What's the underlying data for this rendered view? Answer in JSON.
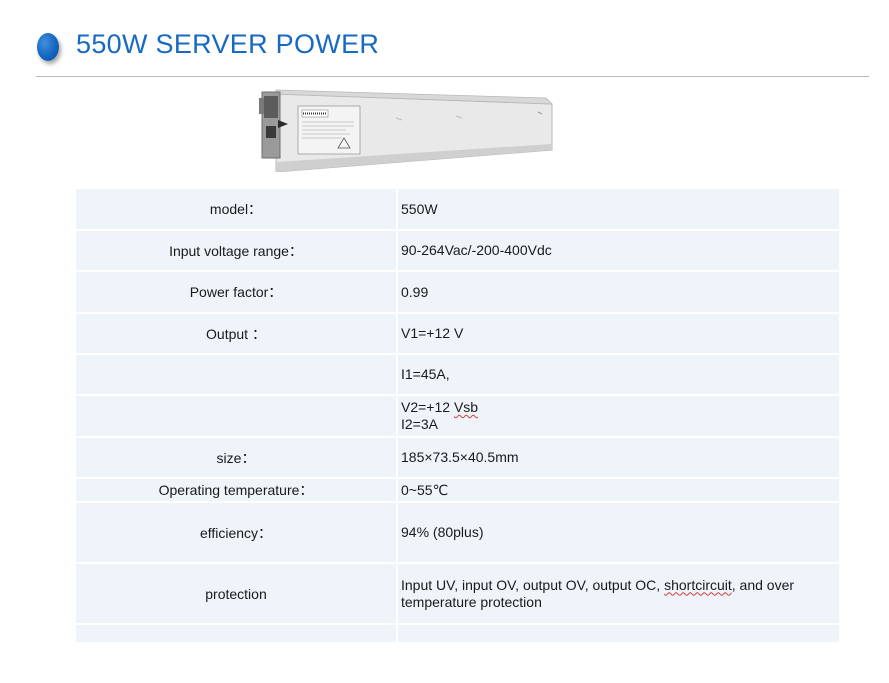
{
  "header": {
    "title": "550W SERVER POWER",
    "accent_color": "#1869c4"
  },
  "product_image": {
    "icon": "power-supply-unit-image"
  },
  "specs": {
    "rows": [
      {
        "label": "model：",
        "value": "550W"
      },
      {
        "label": "Input voltage range：",
        "value": "90-264Vac/-200-400Vdc"
      },
      {
        "label": "Power factor：",
        "value": "0.99"
      },
      {
        "label": "Output ：",
        "value": "V1=+12 V"
      },
      {
        "label": "",
        "value": "I1=45A,"
      },
      {
        "label": "",
        "value_line1_prefix": "V2=+12 ",
        "value_line1_squig": "Vsb",
        "value_line2": "I2=3A"
      },
      {
        "label": "size：",
        "value": "185×73.5×40.5mm"
      },
      {
        "label": "Operating temperature：",
        "value": "0~55℃"
      },
      {
        "label": "efficiency：",
        "value": "94% (80plus)"
      },
      {
        "label": "protection",
        "value_prefix": "Input UV, input OV, output OV, output OC, ",
        "value_squig": "shortcircuit",
        "value_suffix": ", and over temperature protection"
      },
      {
        "label": "",
        "value": ""
      }
    ]
  }
}
